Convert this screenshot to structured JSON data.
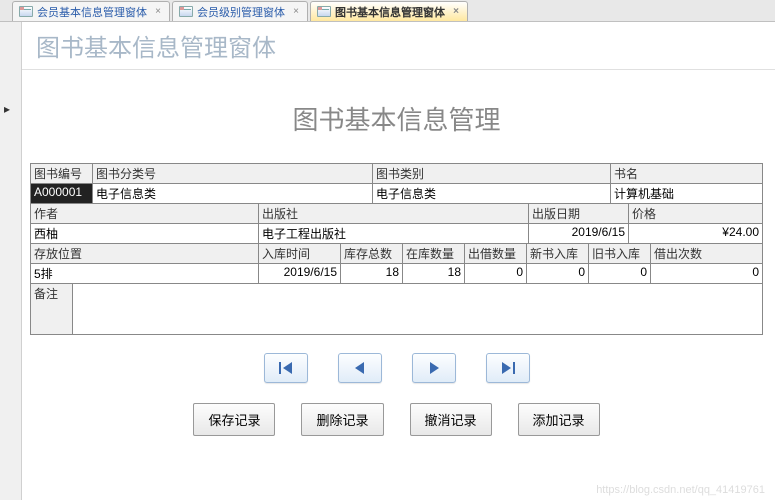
{
  "tabs": [
    {
      "label": "会员基本信息管理窗体"
    },
    {
      "label": "会员级别管理窗体"
    },
    {
      "label": "图书基本信息管理窗体"
    }
  ],
  "header_title": "图书基本信息管理窗体",
  "page_title": "图书基本信息管理",
  "labels": {
    "book_no": "图书编号",
    "category_no": "图书分类号",
    "category": "图书类别",
    "title": "书名",
    "author": "作者",
    "publisher": "出版社",
    "pub_date": "出版日期",
    "price": "价格",
    "location": "存放位置",
    "stock_date": "入库时间",
    "total": "库存总数",
    "in_stock": "在库数量",
    "lent": "出借数量",
    "new_in": "新书入库",
    "old_in": "旧书入库",
    "lend_count": "借出次数",
    "memo": "备注"
  },
  "values": {
    "book_no": "A000001",
    "category_no": "电子信息类",
    "category": "电子信息类",
    "title": "计算机基础",
    "author": "西柚",
    "publisher": "电子工程出版社",
    "pub_date": "2019/6/15",
    "price": "¥24.00",
    "location": "5排",
    "stock_date": "2019/6/15",
    "total": "18",
    "in_stock": "18",
    "lent": "0",
    "new_in": "0",
    "old_in": "0",
    "lend_count": "0",
    "memo": ""
  },
  "buttons": {
    "save": "保存记录",
    "delete": "删除记录",
    "cancel": "撤消记录",
    "add": "添加记录"
  },
  "watermark": "https://blog.csdn.net/qq_41419761"
}
